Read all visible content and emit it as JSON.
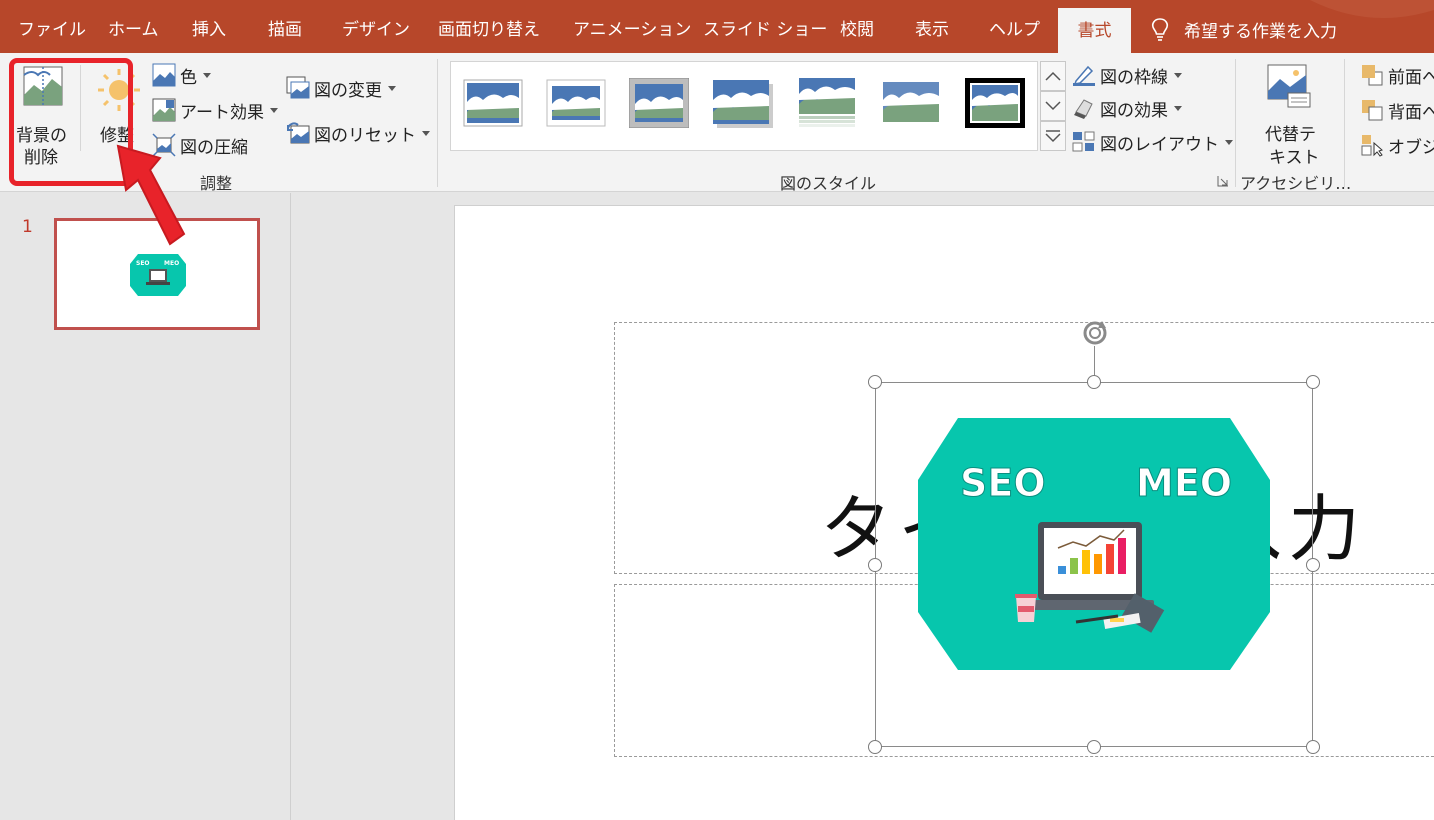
{
  "tabs": [
    {
      "label": "ファイル"
    },
    {
      "label": "ホーム"
    },
    {
      "label": "挿入"
    },
    {
      "label": "描画"
    },
    {
      "label": "デザイン"
    },
    {
      "label": "画面切り替え"
    },
    {
      "label": "アニメーション"
    },
    {
      "label": "スライド ショー"
    },
    {
      "label": "校閲"
    },
    {
      "label": "表示"
    },
    {
      "label": "ヘルプ"
    },
    {
      "label": "書式"
    }
  ],
  "active_tab": "書式",
  "tell_me": "希望する作業を入力",
  "adjust": {
    "remove_bg_line1": "背景の",
    "remove_bg_line2": "削除",
    "corrections": "修整",
    "color": "色",
    "artistic": "アート効果",
    "compress": "図の圧縮",
    "change": "図の変更",
    "reset": "図のリセット",
    "group_label": "調整"
  },
  "styles": {
    "border": "図の枠線",
    "effects": "図の効果",
    "layout": "図のレイアウト",
    "group_label": "図のスタイル"
  },
  "accessibility": {
    "alt_line1": "代替テ",
    "alt_line2": "キスト",
    "group_label": "アクセシビリ…"
  },
  "arrange": {
    "bring_forward": "前面へ",
    "send_backward": "背面へ",
    "selection_pane": "オブジェ"
  },
  "slide": {
    "number": "1",
    "title_text": "タイトルを入力",
    "image_labels": {
      "seo": "SEO",
      "meo": "MEO"
    }
  },
  "colors": {
    "accent": "#b7472a",
    "image_bg": "#07c6ad",
    "highlight": "#e8232a"
  }
}
